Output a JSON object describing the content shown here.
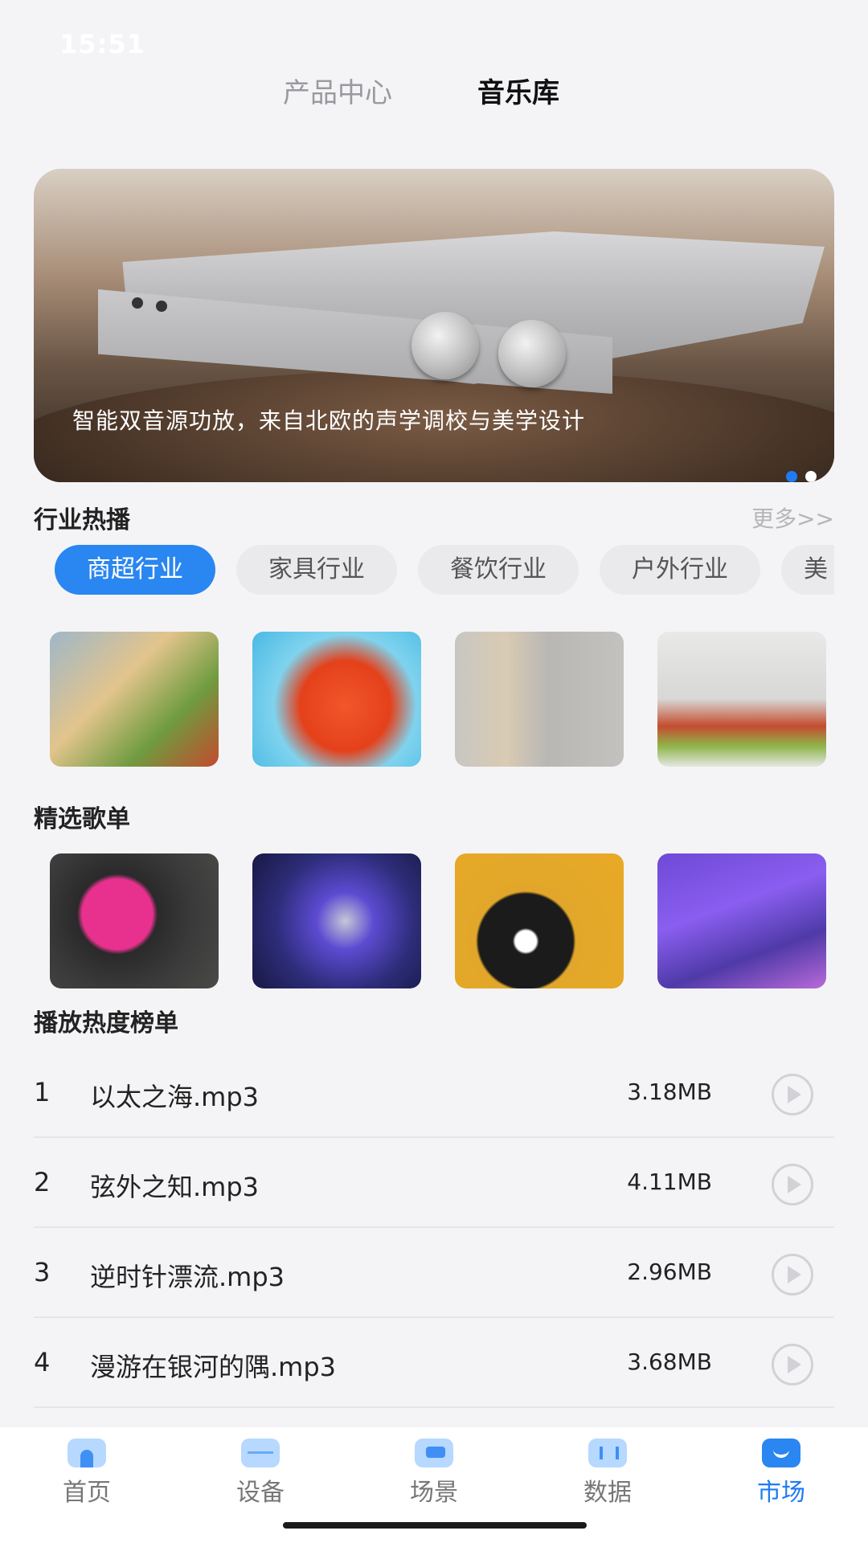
{
  "status_bar": {
    "time": "15:51"
  },
  "top_tabs": {
    "product_center": "产品中心",
    "music_library": "音乐库"
  },
  "banner": {
    "caption": "智能双音源功放，来自北欧的声学调校与美学设计",
    "page_count": 2,
    "active_page": 1
  },
  "industry": {
    "title": "行业热播",
    "more": "更多>>",
    "chips": [
      "商超行业",
      "家具行业",
      "餐饮行业",
      "户外行业",
      "美"
    ],
    "images": [
      "grocery-shopping-image",
      "tomato-water-image",
      "slippers-towel-image",
      "snack-jars-image"
    ]
  },
  "playlists": {
    "title": "精选歌单",
    "images": [
      "vinyl-pink-image",
      "microphone-image",
      "vinyl-music-notes-image",
      "mixer-console-image"
    ]
  },
  "ranking": {
    "title": "播放热度榜单",
    "rows": [
      {
        "rank": "1",
        "name": "以太之海.mp3",
        "size": "3.18MB"
      },
      {
        "rank": "2",
        "name": "弦外之知.mp3",
        "size": "4.11MB"
      },
      {
        "rank": "3",
        "name": "逆时针漂流.mp3",
        "size": "2.96MB"
      },
      {
        "rank": "4",
        "name": "漫游在银河的隅.mp3",
        "size": "3.68MB"
      }
    ]
  },
  "tabbar": {
    "items": [
      {
        "label": "首页",
        "icon": "home-icon"
      },
      {
        "label": "设备",
        "icon": "device-icon"
      },
      {
        "label": "场景",
        "icon": "scene-icon"
      },
      {
        "label": "数据",
        "icon": "data-icon"
      },
      {
        "label": "市场",
        "icon": "market-icon"
      }
    ],
    "active": 4
  },
  "colors": {
    "accent": "#2a86f0",
    "background": "#f4f4f7"
  }
}
